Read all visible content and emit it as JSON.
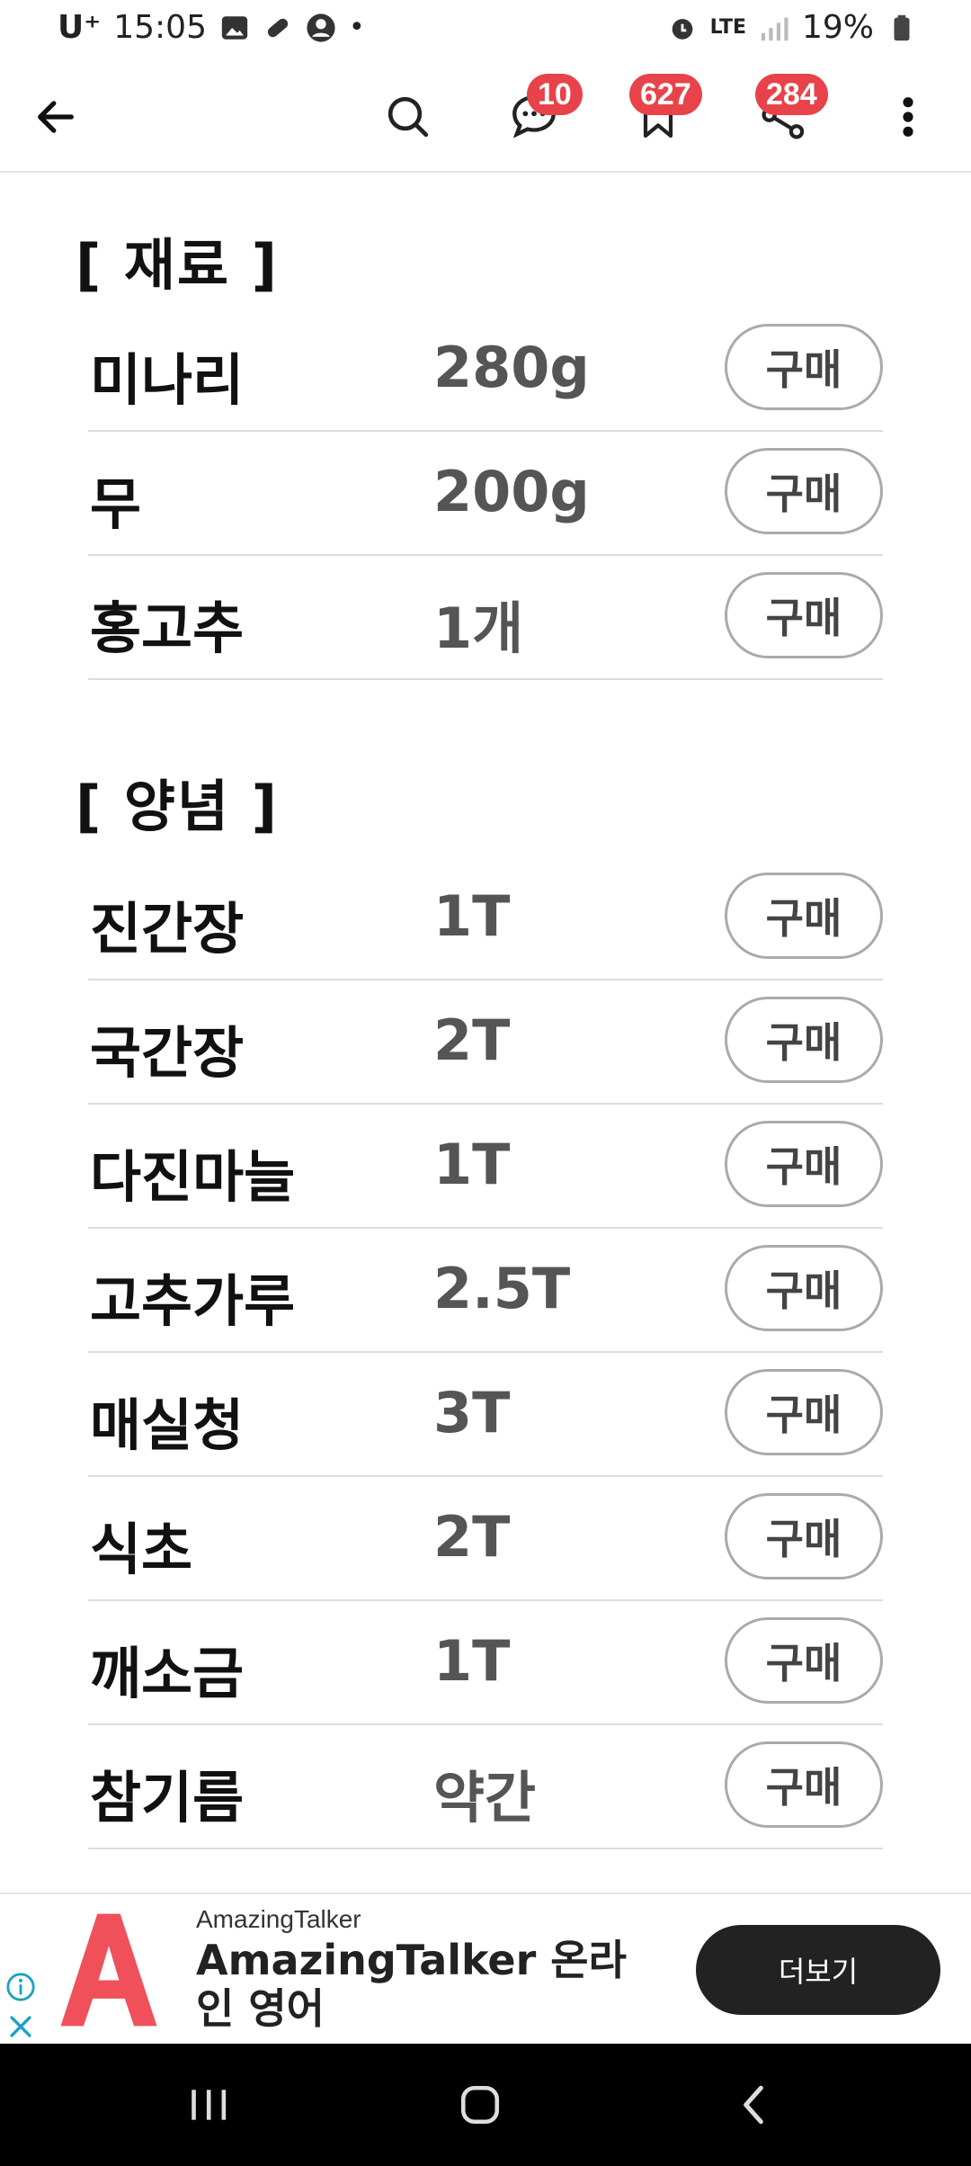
{
  "status_bar": {
    "carrier": "U⁺",
    "time": "15:05",
    "dot": "•",
    "battery": "19%",
    "network": "LTE"
  },
  "app_bar": {
    "comment_count": "10",
    "bookmark_count": "627",
    "share_count": "284"
  },
  "sections": [
    {
      "title": "[ 재료 ]",
      "items": [
        {
          "name": "미나리",
          "amount": "280g",
          "buy": "구매"
        },
        {
          "name": "무",
          "amount": "200g",
          "buy": "구매"
        },
        {
          "name": "홍고추",
          "amount": "1개",
          "buy": "구매"
        }
      ]
    },
    {
      "title": "[ 양념 ]",
      "items": [
        {
          "name": "진간장",
          "amount": "1T",
          "buy": "구매"
        },
        {
          "name": "국간장",
          "amount": "2T",
          "buy": "구매"
        },
        {
          "name": "다진마늘",
          "amount": "1T",
          "buy": "구매"
        },
        {
          "name": "고추가루",
          "amount": "2.5T",
          "buy": "구매"
        },
        {
          "name": "매실청",
          "amount": "3T",
          "buy": "구매"
        },
        {
          "name": "식초",
          "amount": "2T",
          "buy": "구매"
        },
        {
          "name": "깨소금",
          "amount": "1T",
          "buy": "구매"
        },
        {
          "name": "참기름",
          "amount": "약간",
          "buy": "구매"
        }
      ]
    }
  ],
  "ad": {
    "source": "AmazingTalker",
    "title": "AmazingTalker 온라인 영어",
    "cta": "더보기",
    "logo_color": "#f0505a"
  },
  "colors": {
    "badge": "#e8434a",
    "divider": "#dcdcdc",
    "navbar": "#000000"
  }
}
